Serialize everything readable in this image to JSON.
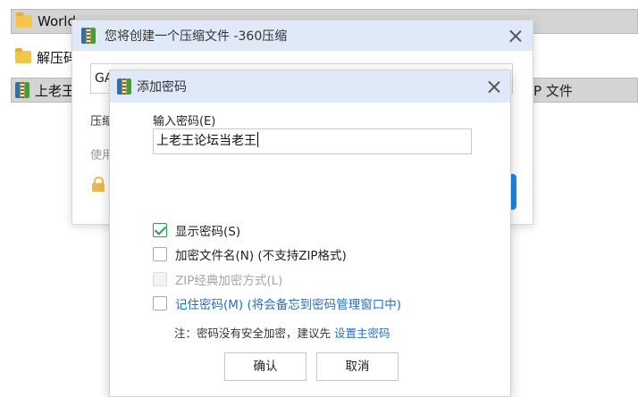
{
  "explorer": {
    "rows": [
      {
        "name": "World",
        "type": "folder",
        "selected": true
      },
      {
        "name": "解压码",
        "type": "folder",
        "selected": false
      },
      {
        "name": "上老王",
        "type": "archive",
        "selected": true,
        "right_text": "P 文件"
      }
    ]
  },
  "back_dialog": {
    "title": "您将创建一个压缩文件 -360压缩",
    "filename_value": "GA",
    "label_compress": "压缩",
    "label_use": "使用"
  },
  "password_dialog": {
    "title": "添加密码",
    "password_label": "输入密码(E)",
    "password_value": "上老王论坛当老王",
    "options": [
      {
        "label": "显示密码(S)",
        "checked": true,
        "disabled": false
      },
      {
        "label": "加密文件名(N) (不支持ZIP格式)",
        "checked": false,
        "disabled": false
      },
      {
        "label": "ZIP经典加密方式(L)",
        "checked": false,
        "disabled": true
      },
      {
        "label": "记住密码(M) (将会备忘到密码管理窗口中)",
        "checked": false,
        "disabled": false,
        "style": "link"
      }
    ],
    "note_prefix": "注：密码没有安全加密，建议先",
    "note_link": "设置主密码",
    "ok_label": "确认",
    "cancel_label": "取消"
  },
  "colors": {
    "titlebar": "#dfe9f8",
    "link": "#1e6fd0",
    "check": "#2e9a55",
    "accent_button": "#1e88e5"
  },
  "icons": {
    "folder": "folder-icon",
    "archive": "archive-icon",
    "close": "close-icon",
    "lock": "lock-icon"
  }
}
